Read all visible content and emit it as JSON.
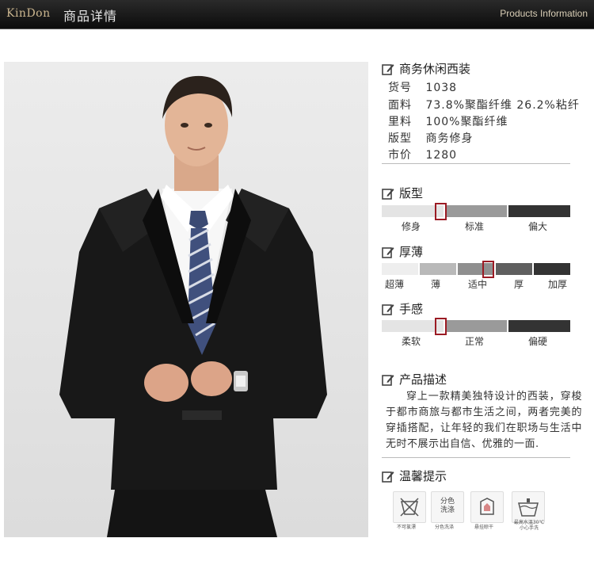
{
  "header": {
    "logo": "KinDon",
    "title": "商品详情",
    "subtitle": "Products Information"
  },
  "product": {
    "name": "商务休闲西装",
    "specs": [
      {
        "key": "货号",
        "value": "1038"
      },
      {
        "key": "面料",
        "value": "73.8%聚酯纤维  26.2%粘纤"
      },
      {
        "key": "里料",
        "value": "100%聚酯纤维"
      },
      {
        "key": "版型",
        "value": "商务修身"
      },
      {
        "key": "市价",
        "value": "1280"
      }
    ]
  },
  "fit": {
    "title": "版型",
    "labels": [
      "修身",
      "标准",
      "偏大"
    ],
    "selected": "修身"
  },
  "thickness": {
    "title": "厚薄",
    "labels": [
      "超薄",
      "薄",
      "适中",
      "厚",
      "加厚"
    ],
    "selected": "适中"
  },
  "feel": {
    "title": "手感",
    "labels": [
      "柔软",
      "正常",
      "偏硬"
    ],
    "selected": "柔软"
  },
  "description": {
    "title": "产品描述",
    "text": "穿上一款精美独特设计的西装，穿梭于都市商旅与都市生活之间，两者完美的穿插搭配，让年轻的我们在职场与生活中无时不展示出自信、优雅的一面."
  },
  "care": {
    "title": "温馨提示",
    "items": [
      {
        "icon": "no-ironing-icon",
        "label": "不可氯漂"
      },
      {
        "icon": "separate-wash-icon",
        "text": "分色\n洗涤",
        "label": "分色洗涤"
      },
      {
        "icon": "hang-dry-icon",
        "label": "悬挂晾干"
      },
      {
        "icon": "hand-wash-icon",
        "label": "最高水温30℃ 小心手洗"
      }
    ]
  },
  "colors": {
    "header_bg": "#111111",
    "logo": "#cbb68f",
    "marker": "#9b1b24",
    "bar_light": "#e4e4e4",
    "bar_mid": "#9a9a9a",
    "bar_dark": "#333333"
  }
}
